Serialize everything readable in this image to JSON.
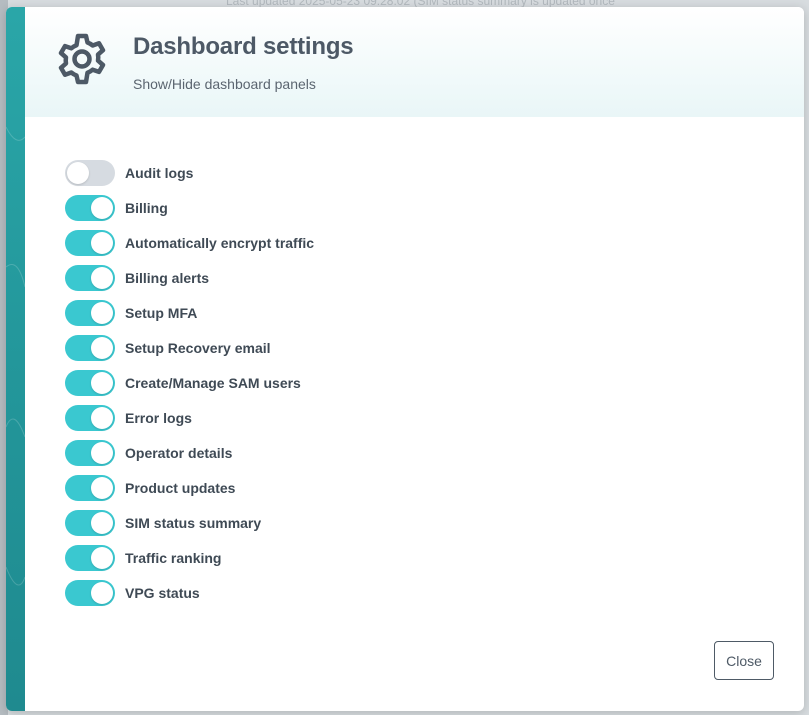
{
  "background": {
    "top_text": "Last updated 2025-05-23 09:28:02 (SIM status summary is updated once"
  },
  "dialog": {
    "title": "Dashboard settings",
    "subtitle": "Show/Hide dashboard panels",
    "header_icon": "gear-icon",
    "close_label": "Close",
    "accent_color": "#2aa6a8",
    "toggle_on_color": "#3ac8d0",
    "toggle_off_color": "#d6dbe1",
    "panels": [
      {
        "label": "Audit logs",
        "enabled": false
      },
      {
        "label": "Billing",
        "enabled": true
      },
      {
        "label": "Automatically encrypt traffic",
        "enabled": true
      },
      {
        "label": "Billing alerts",
        "enabled": true
      },
      {
        "label": "Setup MFA",
        "enabled": true
      },
      {
        "label": "Setup Recovery email",
        "enabled": true
      },
      {
        "label": "Create/Manage SAM users",
        "enabled": true
      },
      {
        "label": "Error logs",
        "enabled": true
      },
      {
        "label": "Operator details",
        "enabled": true
      },
      {
        "label": "Product updates",
        "enabled": true
      },
      {
        "label": "SIM status summary",
        "enabled": true
      },
      {
        "label": "Traffic ranking",
        "enabled": true
      },
      {
        "label": "VPG status",
        "enabled": true
      }
    ]
  }
}
